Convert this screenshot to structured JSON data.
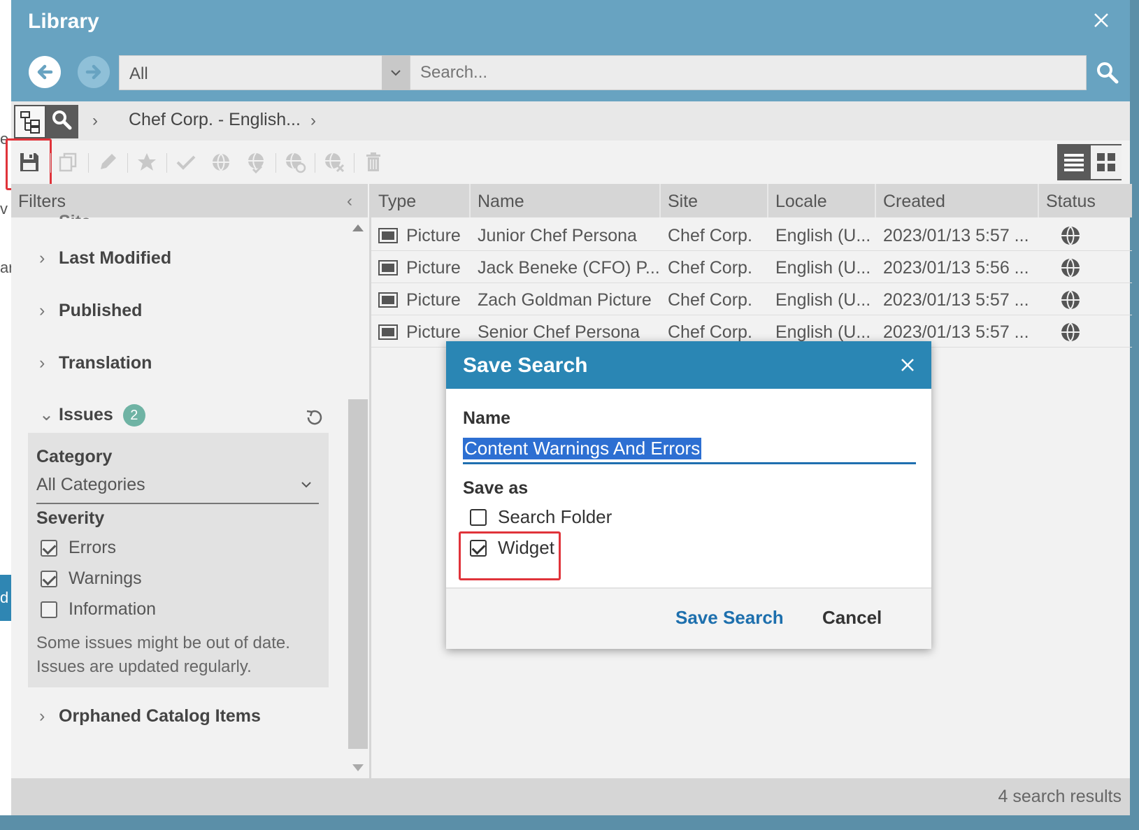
{
  "background": {
    "fragments": [
      "e",
      "v",
      "ar",
      "d"
    ]
  },
  "window": {
    "title": "Library"
  },
  "search": {
    "scope_value": "All",
    "placeholder": "Search..."
  },
  "breadcrumb": {
    "path": "Chef Corp. - English..."
  },
  "filters": {
    "title": "Filters",
    "partial_top": "Site",
    "sections": [
      {
        "label": "Last Modified",
        "expanded": false
      },
      {
        "label": "Published",
        "expanded": false
      },
      {
        "label": "Translation",
        "expanded": false
      },
      {
        "label": "Issues",
        "expanded": true,
        "badge": "2"
      },
      {
        "label": "Orphaned Catalog Items",
        "expanded": false
      }
    ],
    "issues": {
      "category_label": "Category",
      "category_value": "All Categories",
      "severity_label": "Severity",
      "severity_options": [
        {
          "label": "Errors",
          "checked": true
        },
        {
          "label": "Warnings",
          "checked": true
        },
        {
          "label": "Information",
          "checked": false
        }
      ],
      "note": "Some issues might be out of date. Issues are updated regularly."
    }
  },
  "table": {
    "columns": [
      "Type",
      "Name",
      "Site",
      "Locale",
      "Created",
      "Status"
    ],
    "rows": [
      {
        "type": "Picture",
        "name": "Junior Chef Persona",
        "site": "Chef Corp.",
        "locale": "English (U...",
        "created": "2023/01/13 5:57 ..."
      },
      {
        "type": "Picture",
        "name": "Jack Beneke (CFO) P...",
        "site": "Chef Corp.",
        "locale": "English (U...",
        "created": "2023/01/13 5:56 ..."
      },
      {
        "type": "Picture",
        "name": "Zach Goldman Picture",
        "site": "Chef Corp.",
        "locale": "English (U...",
        "created": "2023/01/13 5:57 ..."
      },
      {
        "type": "Picture",
        "name": "Senior Chef Persona",
        "site": "Chef Corp.",
        "locale": "English (U...",
        "created": "2023/01/13 5:57 ..."
      }
    ]
  },
  "status": {
    "result_count": "4 search results"
  },
  "dialog": {
    "title": "Save Search",
    "name_label": "Name",
    "name_value": "Content Warnings And Errors",
    "save_as_label": "Save as",
    "options": [
      {
        "label": "Search Folder",
        "checked": false
      },
      {
        "label": "Widget",
        "checked": true
      }
    ],
    "save_label": "Save Search",
    "cancel_label": "Cancel"
  },
  "colors": {
    "titlebar": "#68a3c1",
    "dialog_header": "#2a86b4",
    "accent_link": "#1d6fad",
    "highlight": "#e0333a",
    "badge": "#6fb3a4"
  }
}
